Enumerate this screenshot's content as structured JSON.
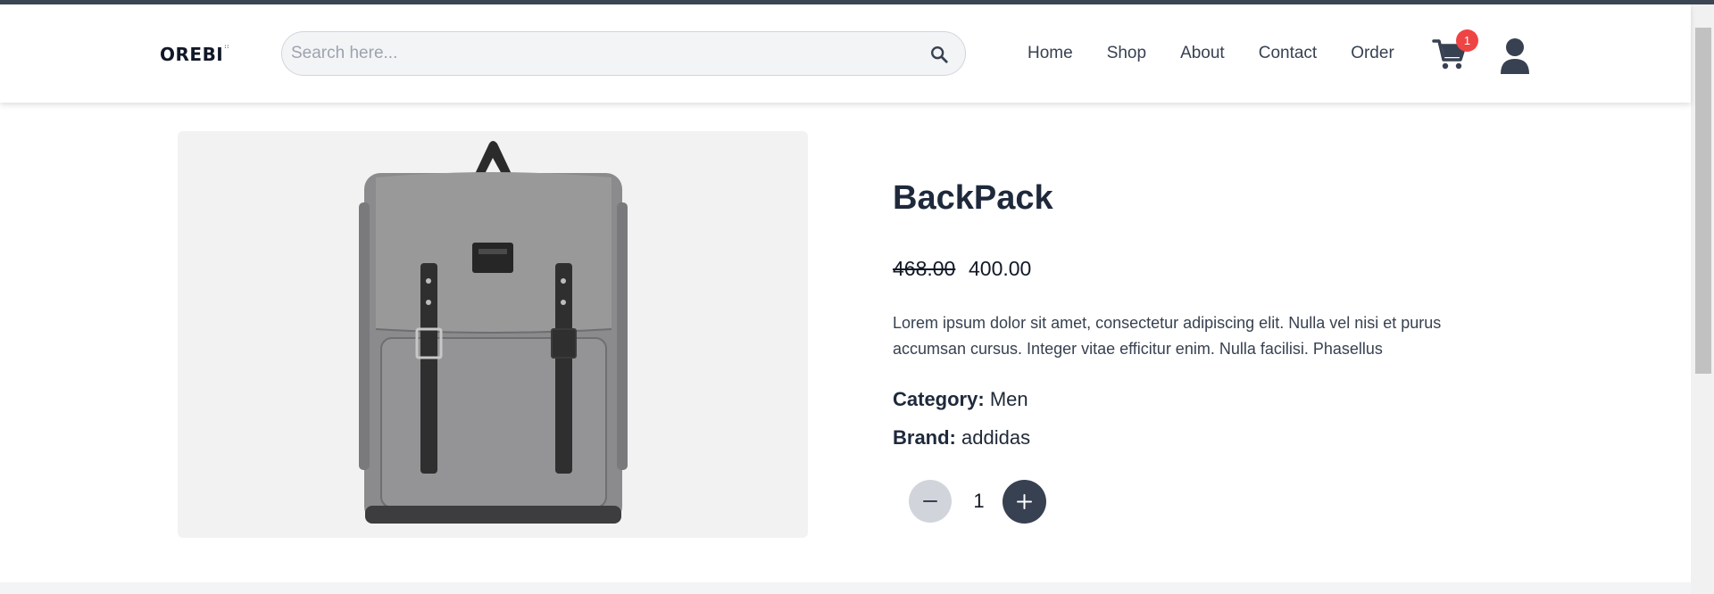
{
  "header": {
    "logo": "OREBI",
    "logo_mark": "::",
    "search": {
      "placeholder": "Search here..."
    },
    "nav": [
      "Home",
      "Shop",
      "About",
      "Contact",
      "Order"
    ],
    "cart_count": "1"
  },
  "product": {
    "title": "BackPack",
    "price_old": "468.00",
    "price_new": "400.00",
    "description": "Lorem ipsum dolor sit amet, consectetur adipiscing elit. Nulla vel nisi et purus accumsan cursus. Integer vitae efficitur enim. Nulla facilisi. Phasellus",
    "category_label": "Category:",
    "category_value": "Men",
    "brand_label": "Brand:",
    "brand_value": "addidas",
    "quantity": "1"
  },
  "icons": {
    "search": "search-icon",
    "cart": "cart-icon",
    "user": "user-icon",
    "minus": "minus-icon",
    "plus": "plus-icon"
  },
  "colors": {
    "badge": "#ef4444",
    "plus_button": "#374151",
    "minus_button": "#d1d5db",
    "title": "#1e293b"
  }
}
